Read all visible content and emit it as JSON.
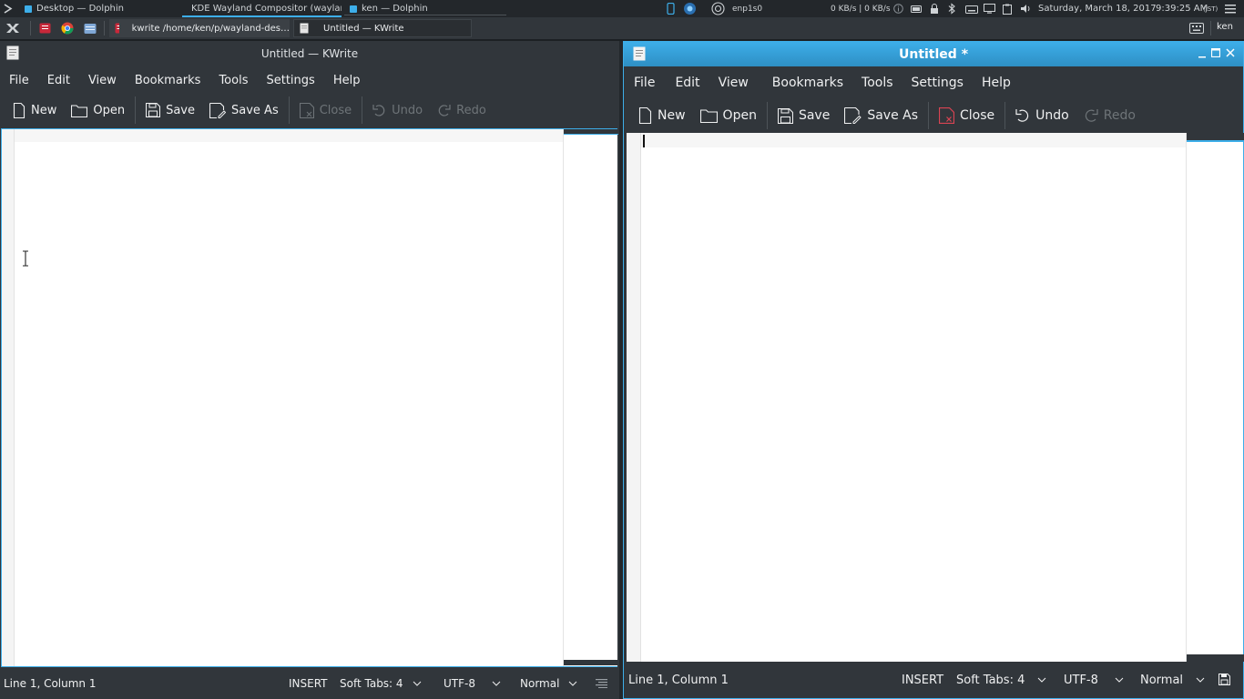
{
  "top_panel": {
    "tasks": [
      {
        "label": "Desktop — Dolphin"
      },
      {
        "label": "KDE Wayland Compositor (waylan…"
      },
      {
        "label": "ken — Dolphin"
      }
    ],
    "network": "enp1s0",
    "netspeed": "0 KB/s | 0 KB/s",
    "datetime": "Saturday, March 18, 2017",
    "time": "9:39:25 AM",
    "timezone": "(JST)"
  },
  "second_panel": {
    "tasks": [
      {
        "label": "kwrite /home/ken/p/wayland-des…"
      },
      {
        "label": "Untitled — KWrite"
      }
    ],
    "user": "ken"
  },
  "left_window": {
    "title": "Untitled — KWrite",
    "menu": [
      "File",
      "Edit",
      "View",
      "Bookmarks",
      "Tools",
      "Settings",
      "Help"
    ],
    "toolbar": {
      "new": "New",
      "open": "Open",
      "save": "Save",
      "save_as": "Save As",
      "close": "Close",
      "undo": "Undo",
      "redo": "Redo"
    },
    "status": {
      "position": "Line 1, Column 1",
      "mode": "INSERT",
      "tabs": "Soft Tabs: 4",
      "encoding": "UTF-8",
      "highlight": "Normal"
    }
  },
  "right_window": {
    "title": "Untitled *",
    "menu": [
      "File",
      "Edit",
      "View",
      "Bookmarks",
      "Tools",
      "Settings",
      "Help"
    ],
    "toolbar": {
      "new": "New",
      "open": "Open",
      "save": "Save",
      "save_as": "Save As",
      "close": "Close",
      "undo": "Undo",
      "redo": "Redo"
    },
    "status": {
      "position": "Line 1, Column 1",
      "mode": "INSERT",
      "tabs": "Soft Tabs: 4",
      "encoding": "UTF-8",
      "highlight": "Normal"
    }
  },
  "colors": {
    "accent": "#3daee9",
    "panel": "#31363b",
    "close_red": "#da4453"
  }
}
